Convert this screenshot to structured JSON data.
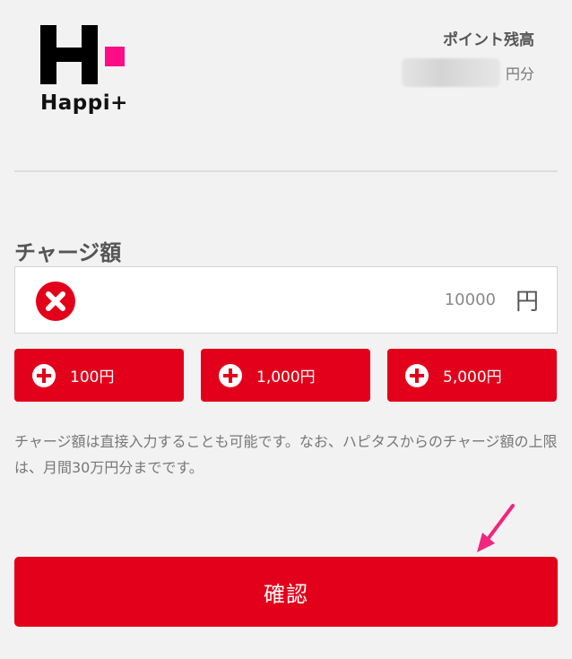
{
  "brand": {
    "name": "Happi+",
    "colors": {
      "primary": "#e3001a",
      "accent": "#ff2d8a",
      "mark": "#000000"
    }
  },
  "points": {
    "label": "ポイント残高",
    "unit": "円分"
  },
  "charge": {
    "label": "チャージ額",
    "amount_value": "10000",
    "amount_unit": "円",
    "clear_icon": "clear-x-icon",
    "presets": [
      {
        "label": "100円",
        "icon": "plus-icon"
      },
      {
        "label": "1,000円",
        "icon": "plus-icon"
      },
      {
        "label": "5,000円",
        "icon": "plus-icon"
      }
    ],
    "note": "チャージ額は直接入力することも可能です。なお、ハピタスからのチャージ額の上限は、月間30万円分までです。"
  },
  "confirm_label": "確認"
}
